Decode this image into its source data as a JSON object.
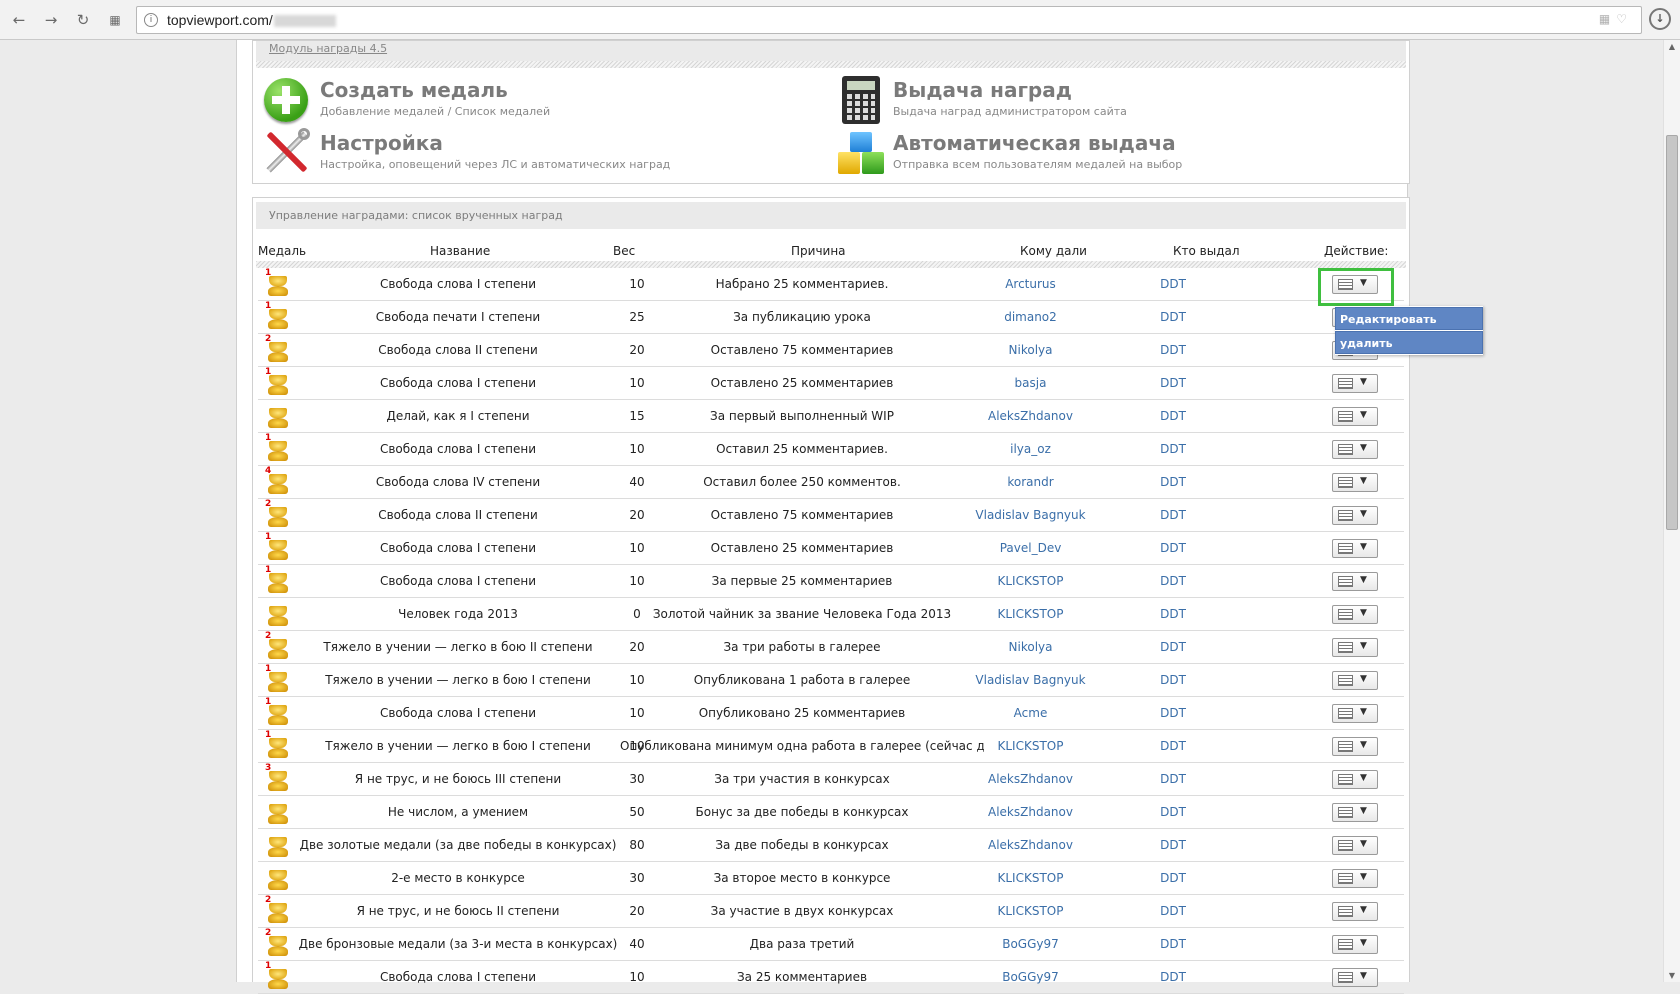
{
  "browser": {
    "url": "topviewport.com/",
    "url_obscured_suffix": "(blurred)"
  },
  "module_label": "Модуль награды 4.5",
  "modules": [
    {
      "title": "Создать медаль",
      "subtitle": "Добавление медалей / Список медалей",
      "icon": "plus-icon"
    },
    {
      "title": "Выдача наград",
      "subtitle": "Выдача наград администратором сайта",
      "icon": "calculator-icon"
    },
    {
      "title": "Настройка",
      "subtitle": "Настройка, оповещений через ЛС и автоматических наград",
      "icon": "tools-icon"
    },
    {
      "title": "Автоматическая выдача",
      "subtitle": "Отправка всем пользователям медалей на выбор",
      "icon": "cubes-icon"
    }
  ],
  "awards_panel_title": "Управление наградами: список врученных наград",
  "columns": {
    "medal": "Медаль",
    "name": "Название",
    "weight": "Вес",
    "reason": "Причина",
    "to": "Кому дали",
    "by": "Кто выдал",
    "action": "Действие:"
  },
  "rows": [
    {
      "num": "1",
      "name": "Свобода слова I степени",
      "weight": "10",
      "reason": "Набрано 25 комментариев.",
      "to": "Arcturus",
      "by": "DDT"
    },
    {
      "num": "1",
      "name": "Свобода печати I степени",
      "weight": "25",
      "reason": "За публикацию урока",
      "to": "dimano2",
      "by": "DDT"
    },
    {
      "num": "2",
      "name": "Свобода слова II степени",
      "weight": "20",
      "reason": "Оставлено 75 комментариев",
      "to": "Nikolya",
      "by": "DDT"
    },
    {
      "num": "1",
      "name": "Свобода слова I степени",
      "weight": "10",
      "reason": "Оставлено 25 комментариев",
      "to": "basja",
      "by": "DDT"
    },
    {
      "num": "",
      "name": "Делай, как я I степени",
      "weight": "15",
      "reason": "За первый выполненный WIP",
      "to": "AleksZhdanov",
      "by": "DDT"
    },
    {
      "num": "1",
      "name": "Свобода слова I степени",
      "weight": "10",
      "reason": "Оставил 25 комментариев.",
      "to": "ilya_oz",
      "by": "DDT"
    },
    {
      "num": "4",
      "name": "Свобода слова IV степени",
      "weight": "40",
      "reason": "Оставил более 250 комментов.",
      "to": "korandr",
      "by": "DDT"
    },
    {
      "num": "2",
      "name": "Свобода слова II степени",
      "weight": "20",
      "reason": "Оставлено 75 комментариев",
      "to": "Vladislav Bagnyuk",
      "by": "DDT"
    },
    {
      "num": "1",
      "name": "Свобода слова I степени",
      "weight": "10",
      "reason": "Оставлено 25 комментариев",
      "to": "Pavel_Dev",
      "by": "DDT"
    },
    {
      "num": "1",
      "name": "Свобода слова I степени",
      "weight": "10",
      "reason": "За первые 25 комментариев",
      "to": "KLICKSTOP",
      "by": "DDT"
    },
    {
      "num": "",
      "name": "Человек года 2013",
      "weight": "0",
      "reason": "Золотой чайник за звание Человека Года 2013",
      "to": "KLICKSTOP",
      "by": "DDT"
    },
    {
      "num": "2",
      "name": "Тяжело в учении — легко в бою II степени",
      "weight": "20",
      "reason": "За три работы в галерее",
      "to": "Nikolya",
      "by": "DDT"
    },
    {
      "num": "1",
      "name": "Тяжело в учении — легко в бою I степени",
      "weight": "10",
      "reason": "Опубликована 1 работа в галерее",
      "to": "Vladislav Bagnyuk",
      "by": "DDT"
    },
    {
      "num": "1",
      "name": "Свобода слова I степени",
      "weight": "10",
      "reason": "Опубликовано 25 комментариев",
      "to": "Acme",
      "by": "DDT"
    },
    {
      "num": "1",
      "name": "Тяжело в учении — легко в бою I степени",
      "weight": "10",
      "reason": "Опубликована минимум одна работа в галерее (сейчас две)",
      "to": "KLICKSTOP",
      "by": "DDT"
    },
    {
      "num": "3",
      "name": "Я не трус, и не боюсь III степени",
      "weight": "30",
      "reason": "За три участия в конкурсах",
      "to": "AleksZhdanov",
      "by": "DDT"
    },
    {
      "num": "",
      "name": "Не числом, а умением",
      "weight": "50",
      "reason": "Бонус за две победы в конкурсах",
      "to": "AleksZhdanov",
      "by": "DDT"
    },
    {
      "num": "",
      "name": "Две золотые медали (за две победы в конкурсах)",
      "weight": "80",
      "reason": "За две победы в конкурсах",
      "to": "AleksZhdanov",
      "by": "DDT"
    },
    {
      "num": "",
      "name": "2-е место в конкурсе",
      "weight": "30",
      "reason": "За второе место в конкурсе",
      "to": "KLICKSTOP",
      "by": "DDT"
    },
    {
      "num": "2",
      "name": "Я не трус, и не боюсь II степени",
      "weight": "20",
      "reason": "За участие в двух конкурсах",
      "to": "KLICKSTOP",
      "by": "DDT"
    },
    {
      "num": "2",
      "name": "Две бронзовые медали (за 3-и места в конкурсах)",
      "weight": "40",
      "reason": "Два раза третий",
      "to": "BoGGy97",
      "by": "DDT"
    },
    {
      "num": "1",
      "name": "Свобода слова I степени",
      "weight": "10",
      "reason": "За 25 комментариев",
      "to": "BoGGy97",
      "by": "DDT"
    }
  ],
  "dropdown": {
    "edit": "Редактировать",
    "delete": "удалить"
  }
}
